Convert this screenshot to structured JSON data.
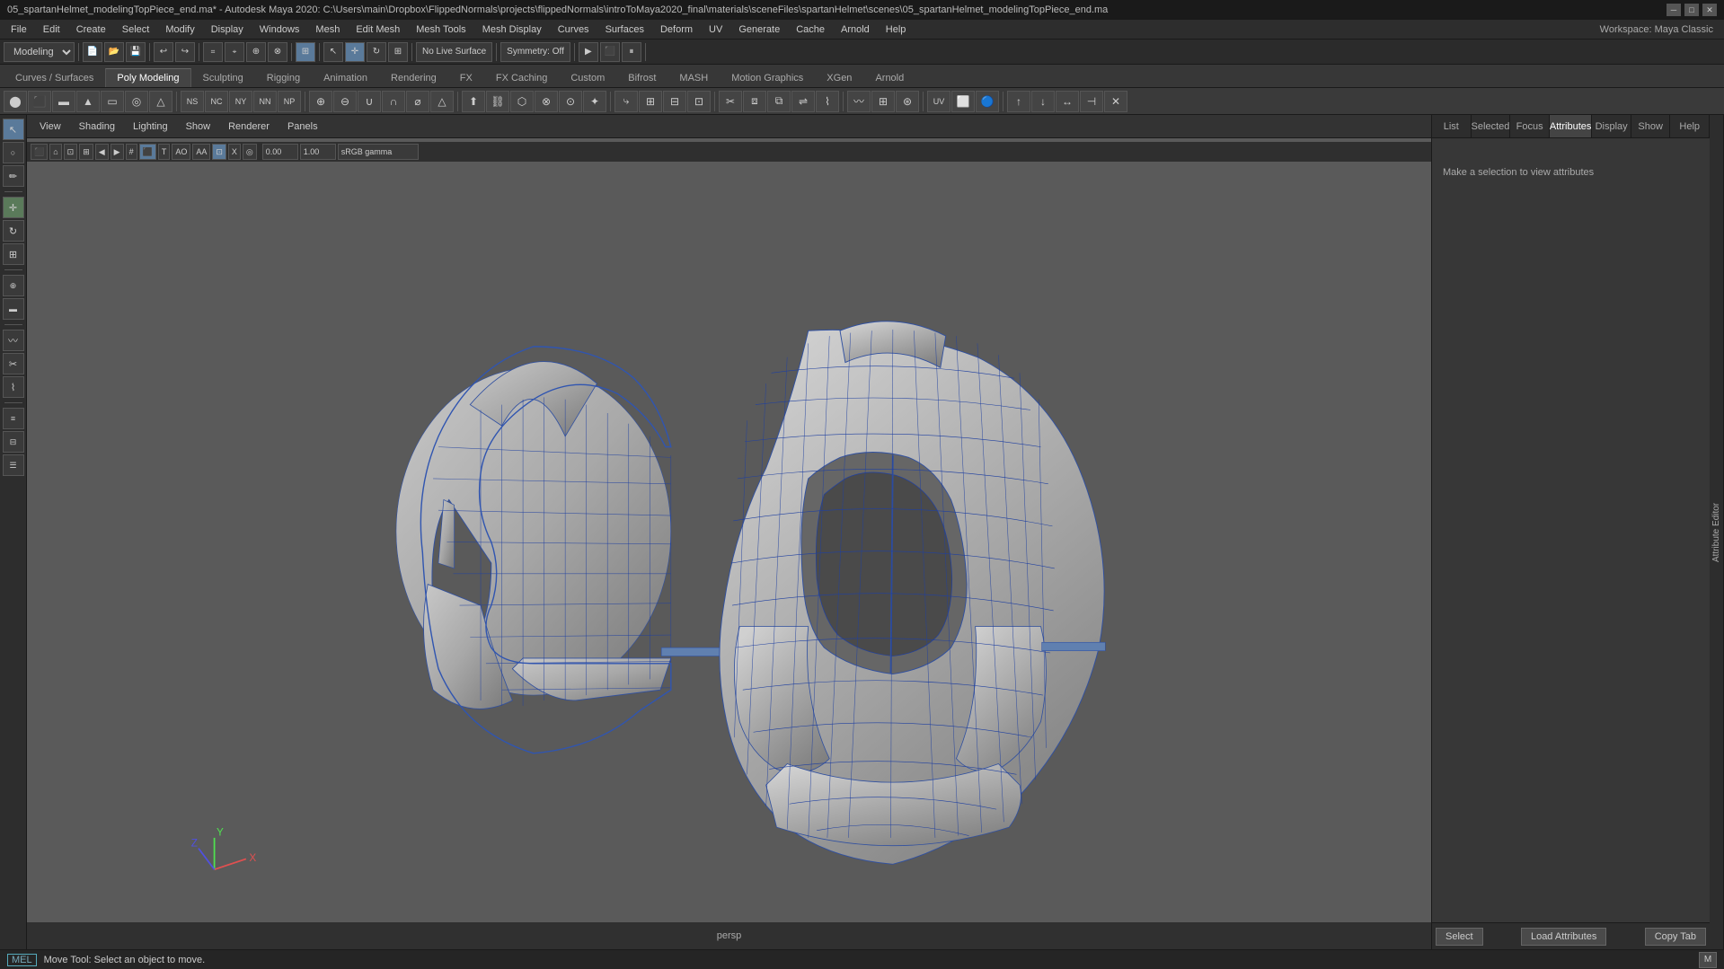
{
  "title_bar": {
    "text": "05_spartanHelmet_modelingTopPiece_end.ma* - Autodesk Maya 2020: C:\\Users\\main\\Dropbox\\FlippedNormals\\projects\\flippedNormals\\introToMaya2020_final\\materials\\sceneFiles\\spartanHelmet\\scenes\\05_spartanHelmet_modelingTopPiece_end.ma"
  },
  "menu_bar": {
    "items": [
      "File",
      "Edit",
      "Create",
      "Select",
      "Modify",
      "Display",
      "Windows",
      "Mesh",
      "Edit Mesh",
      "Mesh Tools",
      "Mesh Display",
      "Curves",
      "Surfaces",
      "Deform",
      "UV",
      "Generate",
      "Cache",
      "Arnold",
      "Help"
    ]
  },
  "workspace": "Workspace: Maya Classic",
  "toolbar1": {
    "module": "Modeling"
  },
  "tabs": {
    "items": [
      "Curves / Surfaces",
      "Poly Modeling",
      "Sculpting",
      "Rigging",
      "Animation",
      "Rendering",
      "FX",
      "FX Caching",
      "Custom",
      "Bifrost",
      "MASH",
      "Motion Graphics",
      "XGen",
      "Arnold"
    ],
    "active": "Poly Modeling"
  },
  "viewport": {
    "menus": [
      "View",
      "Shading",
      "Lighting",
      "Show",
      "Renderer",
      "Panels"
    ],
    "persp_label": "persp",
    "live_surface": "No Live Surface",
    "symmetry": "Symmetry: Off",
    "gamma": "sRGB gamma"
  },
  "right_panel": {
    "tabs": [
      "List",
      "Selected",
      "Focus",
      "Attributes",
      "Display",
      "Show",
      "Help"
    ],
    "active_tab": "Attributes",
    "info_text": "Make a selection to view attributes",
    "footer_buttons": [
      "Select",
      "Load Attributes",
      "Copy Tab"
    ]
  },
  "attr_side_tab": "Attribute Editor",
  "status_bar": {
    "mel_label": "MEL",
    "status_text": "Move Tool: Select an object to move."
  },
  "icons": {
    "transform": "↖",
    "arrow": "↖",
    "rotate": "↻",
    "scale": "⊞",
    "move": "✛",
    "snap": "⌖",
    "magnet": "⚙",
    "camera": "⬛",
    "render": "▶",
    "select_tool": "↖",
    "lasso": "○",
    "paint": "✏",
    "sculpt": "~",
    "rivet": "◆",
    "box": "□",
    "sphere": "○",
    "cylinder": "⬤",
    "cone": "▲",
    "plane": "▭",
    "torus": "◎",
    "nurbs": "∿",
    "extrude": "⬆",
    "bevel": "⬡",
    "bridge": "⛓",
    "merge": "⊕",
    "split": "✂",
    "insert_loop": "⊞",
    "multi_cut": "⚔",
    "offset": "⊟"
  },
  "coordinate_axes": {
    "x_color": "#e05050",
    "y_color": "#50e050",
    "z_color": "#5050e0"
  }
}
